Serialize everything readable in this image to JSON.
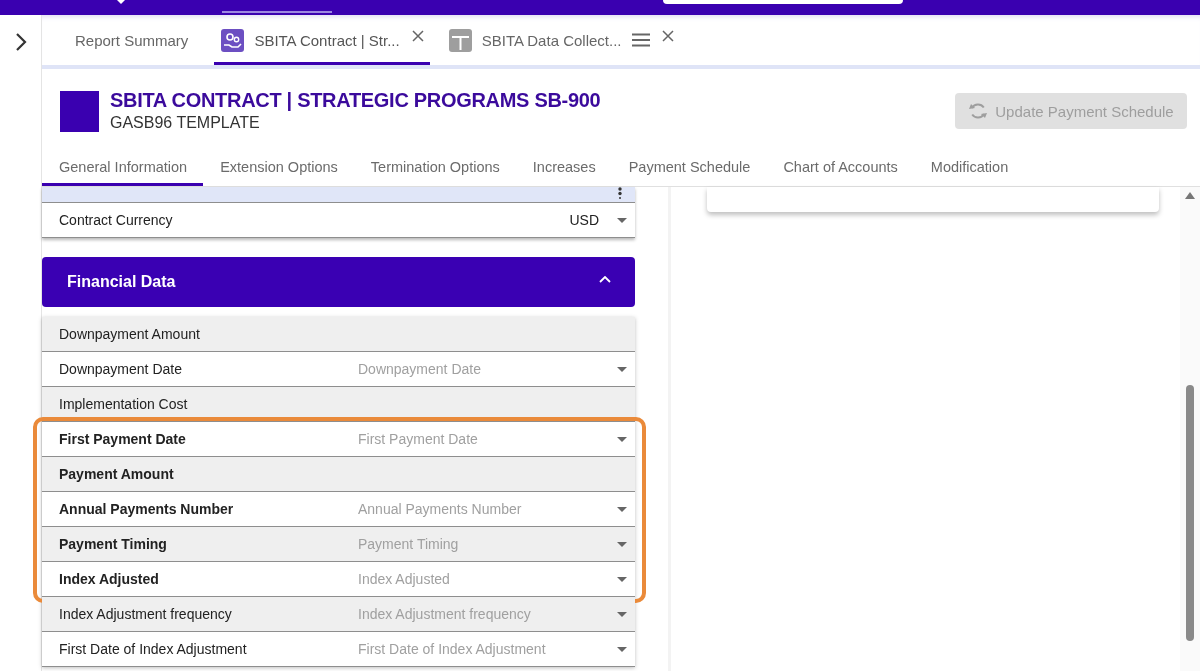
{
  "tabs": [
    {
      "label": "Report Summary",
      "kind": "plain",
      "selected": false,
      "closable": false,
      "menu": false
    },
    {
      "label": "SBITA Contract | Str...",
      "kind": "form",
      "selected": true,
      "closable": true,
      "menu": false
    },
    {
      "label": "SBITA Data Collect...",
      "kind": "sheet",
      "selected": false,
      "closable": true,
      "menu": true
    }
  ],
  "header": {
    "title": "SBITA CONTRACT | STRATEGIC PROGRAMS SB-900",
    "subtitle": "GASB96 TEMPLATE",
    "action": {
      "label": "Update Payment Schedule",
      "disabled": true
    }
  },
  "section_tabs": [
    {
      "label": "General Information",
      "selected": true
    },
    {
      "label": "Extension Options",
      "selected": false
    },
    {
      "label": "Termination Options",
      "selected": false
    },
    {
      "label": "Increases",
      "selected": false
    },
    {
      "label": "Payment Schedule",
      "selected": false
    },
    {
      "label": "Chart of Accounts",
      "selected": false
    },
    {
      "label": "Modification",
      "selected": false
    }
  ],
  "contract_rows": [
    {
      "kind": "cut",
      "selected": true
    },
    {
      "kind": "dropdown",
      "label": "Contract Currency",
      "value": "USD",
      "selected": false
    }
  ],
  "financial": {
    "title": "Financial Data",
    "expanded": true,
    "rows": [
      {
        "label": "Downpayment Amount",
        "kind": "amount",
        "emphasized": false,
        "highlighted": false
      },
      {
        "label": "Downpayment Date",
        "kind": "dropdown",
        "placeholder": "Downpayment Date",
        "emphasized": false,
        "highlighted": false
      },
      {
        "label": "Implementation Cost",
        "kind": "amount",
        "emphasized": false,
        "highlighted": false
      },
      {
        "label": "First Payment Date",
        "kind": "dropdown",
        "placeholder": "First Payment Date",
        "emphasized": true,
        "highlighted": true
      },
      {
        "label": "Payment Amount",
        "kind": "amount",
        "emphasized": true,
        "highlighted": true
      },
      {
        "label": "Annual Payments Number",
        "kind": "dropdown",
        "placeholder": "Annual Payments Number",
        "emphasized": true,
        "highlighted": true
      },
      {
        "label": "Payment Timing",
        "kind": "dropdown",
        "placeholder": "Payment Timing",
        "emphasized": true,
        "highlighted": true
      },
      {
        "label": "Index Adjusted",
        "kind": "dropdown",
        "placeholder": "Index Adjusted",
        "emphasized": true,
        "highlighted": true
      },
      {
        "label": "Index Adjustment frequency",
        "kind": "dropdown",
        "placeholder": "Index Adjustment frequency",
        "emphasized": false,
        "highlighted": false
      },
      {
        "label": "First Date of Index Adjustment",
        "kind": "dropdown",
        "placeholder": "First Date of Index Adjustment",
        "emphasized": false,
        "highlighted": false
      }
    ]
  }
}
